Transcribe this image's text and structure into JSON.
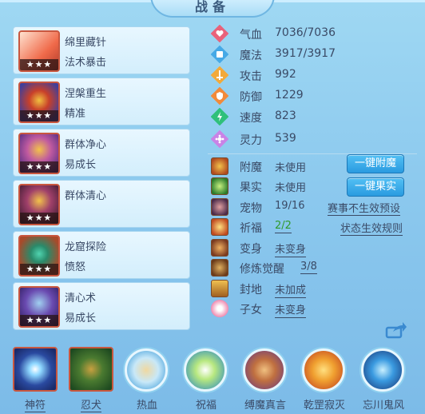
{
  "title": "战备",
  "skills": [
    {
      "name": "绵里藏针",
      "sub": "法术暴击",
      "stars": "★★★",
      "colors": [
        "#f06a4a",
        "#ffe2d0"
      ]
    },
    {
      "name": "涅槃重生",
      "sub": "精准",
      "stars": "★★★",
      "colors": [
        "#3f3f9a",
        "#f0c040"
      ]
    },
    {
      "name": "群体净心",
      "sub": "易成长",
      "stars": "★★★",
      "colors": [
        "#7b3fa0",
        "#f2c24a"
      ]
    },
    {
      "name": "群体清心",
      "sub": "",
      "stars": "★★★",
      "colors": [
        "#7a2a50",
        "#f2c24a"
      ]
    },
    {
      "name": "龙窟探险",
      "sub": "愤怒",
      "stars": "★★★",
      "colors": [
        "#a84a2a",
        "#50d4b0"
      ]
    },
    {
      "name": "清心术",
      "sub": "易成长",
      "stars": "★★★",
      "colors": [
        "#5a3aa0",
        "#a0d0f0"
      ]
    }
  ],
  "stats": [
    {
      "label": "气血",
      "value": "7036/7036",
      "icon": "heart-icon",
      "color": "#e9627a"
    },
    {
      "label": "魔法",
      "value": "3917/3917",
      "icon": "mana-icon",
      "color": "#46a9e6"
    },
    {
      "label": "攻击",
      "value": "992",
      "icon": "attack-icon",
      "color": "#f2a93a"
    },
    {
      "label": "防御",
      "value": "1229",
      "icon": "defense-icon",
      "color": "#f28a3a"
    },
    {
      "label": "速度",
      "value": "823",
      "icon": "speed-icon",
      "color": "#2fc07a"
    },
    {
      "label": "灵力",
      "value": "539",
      "icon": "spirit-icon",
      "color": "#c983e6"
    }
  ],
  "props": {
    "enchant": {
      "label": "附魔",
      "value": "未使用"
    },
    "fruit": {
      "label": "果实",
      "value": "未使用"
    },
    "pet": {
      "label": "宠物",
      "value": "19/16"
    },
    "blessing": {
      "label": "祈福",
      "value": "2/2"
    },
    "transform": {
      "label": "变身",
      "value": "未变身"
    },
    "cultivation": {
      "label": "修炼觉醒",
      "value": "3/8"
    },
    "fief": {
      "label": "封地",
      "value": "未加成"
    },
    "child": {
      "label": "子女",
      "value": "未变身"
    }
  },
  "buttons": {
    "enchant_all": "一键附魔",
    "fruit_all": "一键果实"
  },
  "links": {
    "match_preset": "赛事不生效预设",
    "status_rules": "状态生效规则"
  },
  "bottom_skills": [
    {
      "label": "神符",
      "shape": "square",
      "colors": [
        "#1a2a6a",
        "#8fd8ff"
      ]
    },
    {
      "label": "忍犬",
      "shape": "square",
      "colors": [
        "#1e4a20",
        "#c8a040"
      ]
    },
    {
      "label": "热血",
      "shape": "round",
      "colors": [
        "#f0d8a0",
        "#3a9ad8"
      ]
    },
    {
      "label": "祝福",
      "shape": "round",
      "colors": [
        "#b8e880",
        "#2a8ac0"
      ]
    },
    {
      "label": "缚魔真言",
      "shape": "round",
      "colors": [
        "#c07040",
        "#6a3a80"
      ]
    },
    {
      "label": "乾罡寂灭",
      "shape": "round",
      "colors": [
        "#f0a030",
        "#c04020"
      ]
    },
    {
      "label": "忘川鬼风",
      "shape": "round",
      "colors": [
        "#3a9ae0",
        "#1a3a7a"
      ]
    }
  ]
}
